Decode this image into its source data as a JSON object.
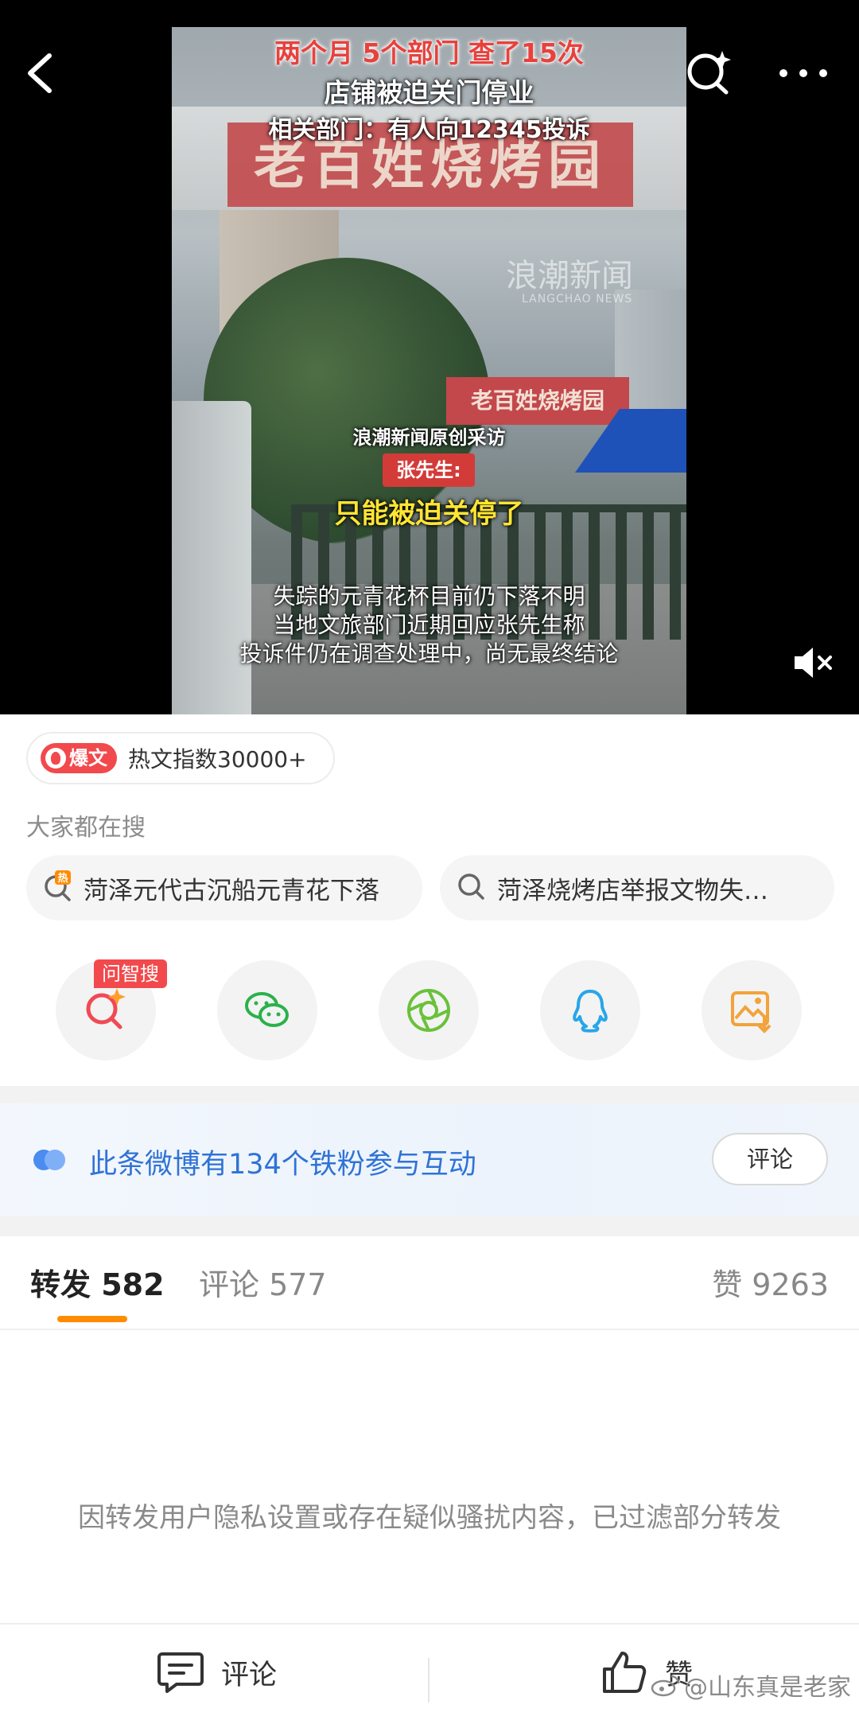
{
  "video": {
    "headline_line1": "两个月  5个部门  查了15次",
    "headline_line2": "店铺被迫关门停业",
    "headline_line3": "相关部门：有人向12345投诉",
    "scene_sign": "老百姓烧烤园",
    "scene_sign_small": "老百姓烧烤园",
    "watermark": "浪潮新闻",
    "watermark_en": "LANGCHAO NEWS",
    "source_caption": "浪潮新闻原创采访",
    "speaker_label": "张先生:",
    "quote": "只能被迫关停了",
    "subtitle_line1": "失踪的元青花杯目前仍下落不明",
    "subtitle_line2": "当地文旅部门近期回应张先生称",
    "subtitle_line3": "投诉件仍在调查处理中，尚无最终结论"
  },
  "hot": {
    "tag": "爆文",
    "index_text": "热文指数30000+"
  },
  "search": {
    "title": "大家都在搜",
    "items": [
      {
        "icon": "hot-search-icon",
        "text": "菏泽元代古沉船元青花下落"
      },
      {
        "icon": "search-icon",
        "text": "菏泽烧烤店举报文物失…"
      }
    ]
  },
  "share": {
    "badge": "问智搜",
    "icons": [
      "ai-search-icon",
      "wechat-icon",
      "moments-icon",
      "qq-icon",
      "save-image-icon"
    ]
  },
  "fans": {
    "text": "此条微博有134个铁粉参与互动",
    "button": "评论"
  },
  "tabs": {
    "repost": "转发 582",
    "comment": "评论 577",
    "like": "赞 9263"
  },
  "notice": "因转发用户隐私设置或存在疑似骚扰内容，已过滤部分转发",
  "bottom_bar": {
    "comment": "评论",
    "like": "赞"
  },
  "credit": "@山东真是老家",
  "colors": {
    "accent_orange": "#ff8c00",
    "hot_red": "#f2494c",
    "fan_blue": "#2f73d6"
  }
}
